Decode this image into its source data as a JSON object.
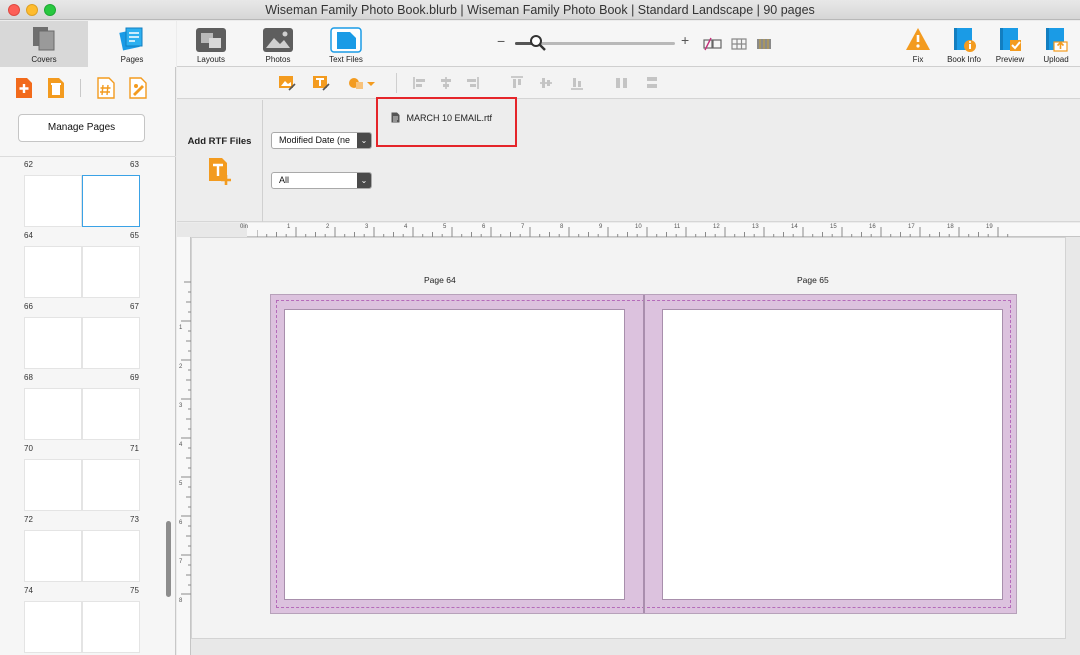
{
  "window": {
    "title": "Wiseman Family Photo Book.blurb | Wiseman Family Photo Book | Standard Landscape | 90 pages"
  },
  "sidebar": {
    "tabs": [
      {
        "label": "Covers",
        "icon": "covers-icon",
        "active": false
      },
      {
        "label": "Pages",
        "icon": "pages-icon",
        "active": true
      }
    ],
    "tools": [
      "add-page-icon",
      "delete-page-icon",
      "page-number-icon",
      "page-settings-icon"
    ],
    "manage_button": "Manage Pages",
    "spreads": [
      {
        "left": "62",
        "right": "63"
      },
      {
        "left": "64",
        "right": "65"
      },
      {
        "left": "66",
        "right": "67"
      },
      {
        "left": "68",
        "right": "69"
      },
      {
        "left": "70",
        "right": "71"
      },
      {
        "left": "72",
        "right": "73"
      },
      {
        "left": "74",
        "right": "75"
      }
    ]
  },
  "toolbar": {
    "layouts": "Layouts",
    "photos": "Photos",
    "text_files": "Text Files",
    "fix": "Fix",
    "book_info": "Book Info",
    "preview": "Preview",
    "upload": "Upload",
    "zoom_minus": "−",
    "zoom_plus": "+",
    "accent": "#1a9be6",
    "warning": "#f39b1f"
  },
  "text_files_panel": {
    "title": "Add RTF Files",
    "sort_value": "Modified Date (ne",
    "filter_value": "All",
    "files": [
      "MARCH 10 EMAIL.rtf"
    ]
  },
  "canvas": {
    "ruler_unit": "0in",
    "ruler_marks": [
      "1",
      "2",
      "3",
      "4",
      "5",
      "6",
      "7",
      "8",
      "9",
      "10",
      "11",
      "12",
      "13",
      "14",
      "15",
      "16",
      "17",
      "18",
      "19"
    ],
    "vertical_marks": [
      "1",
      "2",
      "3",
      "4",
      "5",
      "6",
      "7",
      "8"
    ],
    "left_page_label": "Page 64",
    "right_page_label": "Page 65"
  }
}
